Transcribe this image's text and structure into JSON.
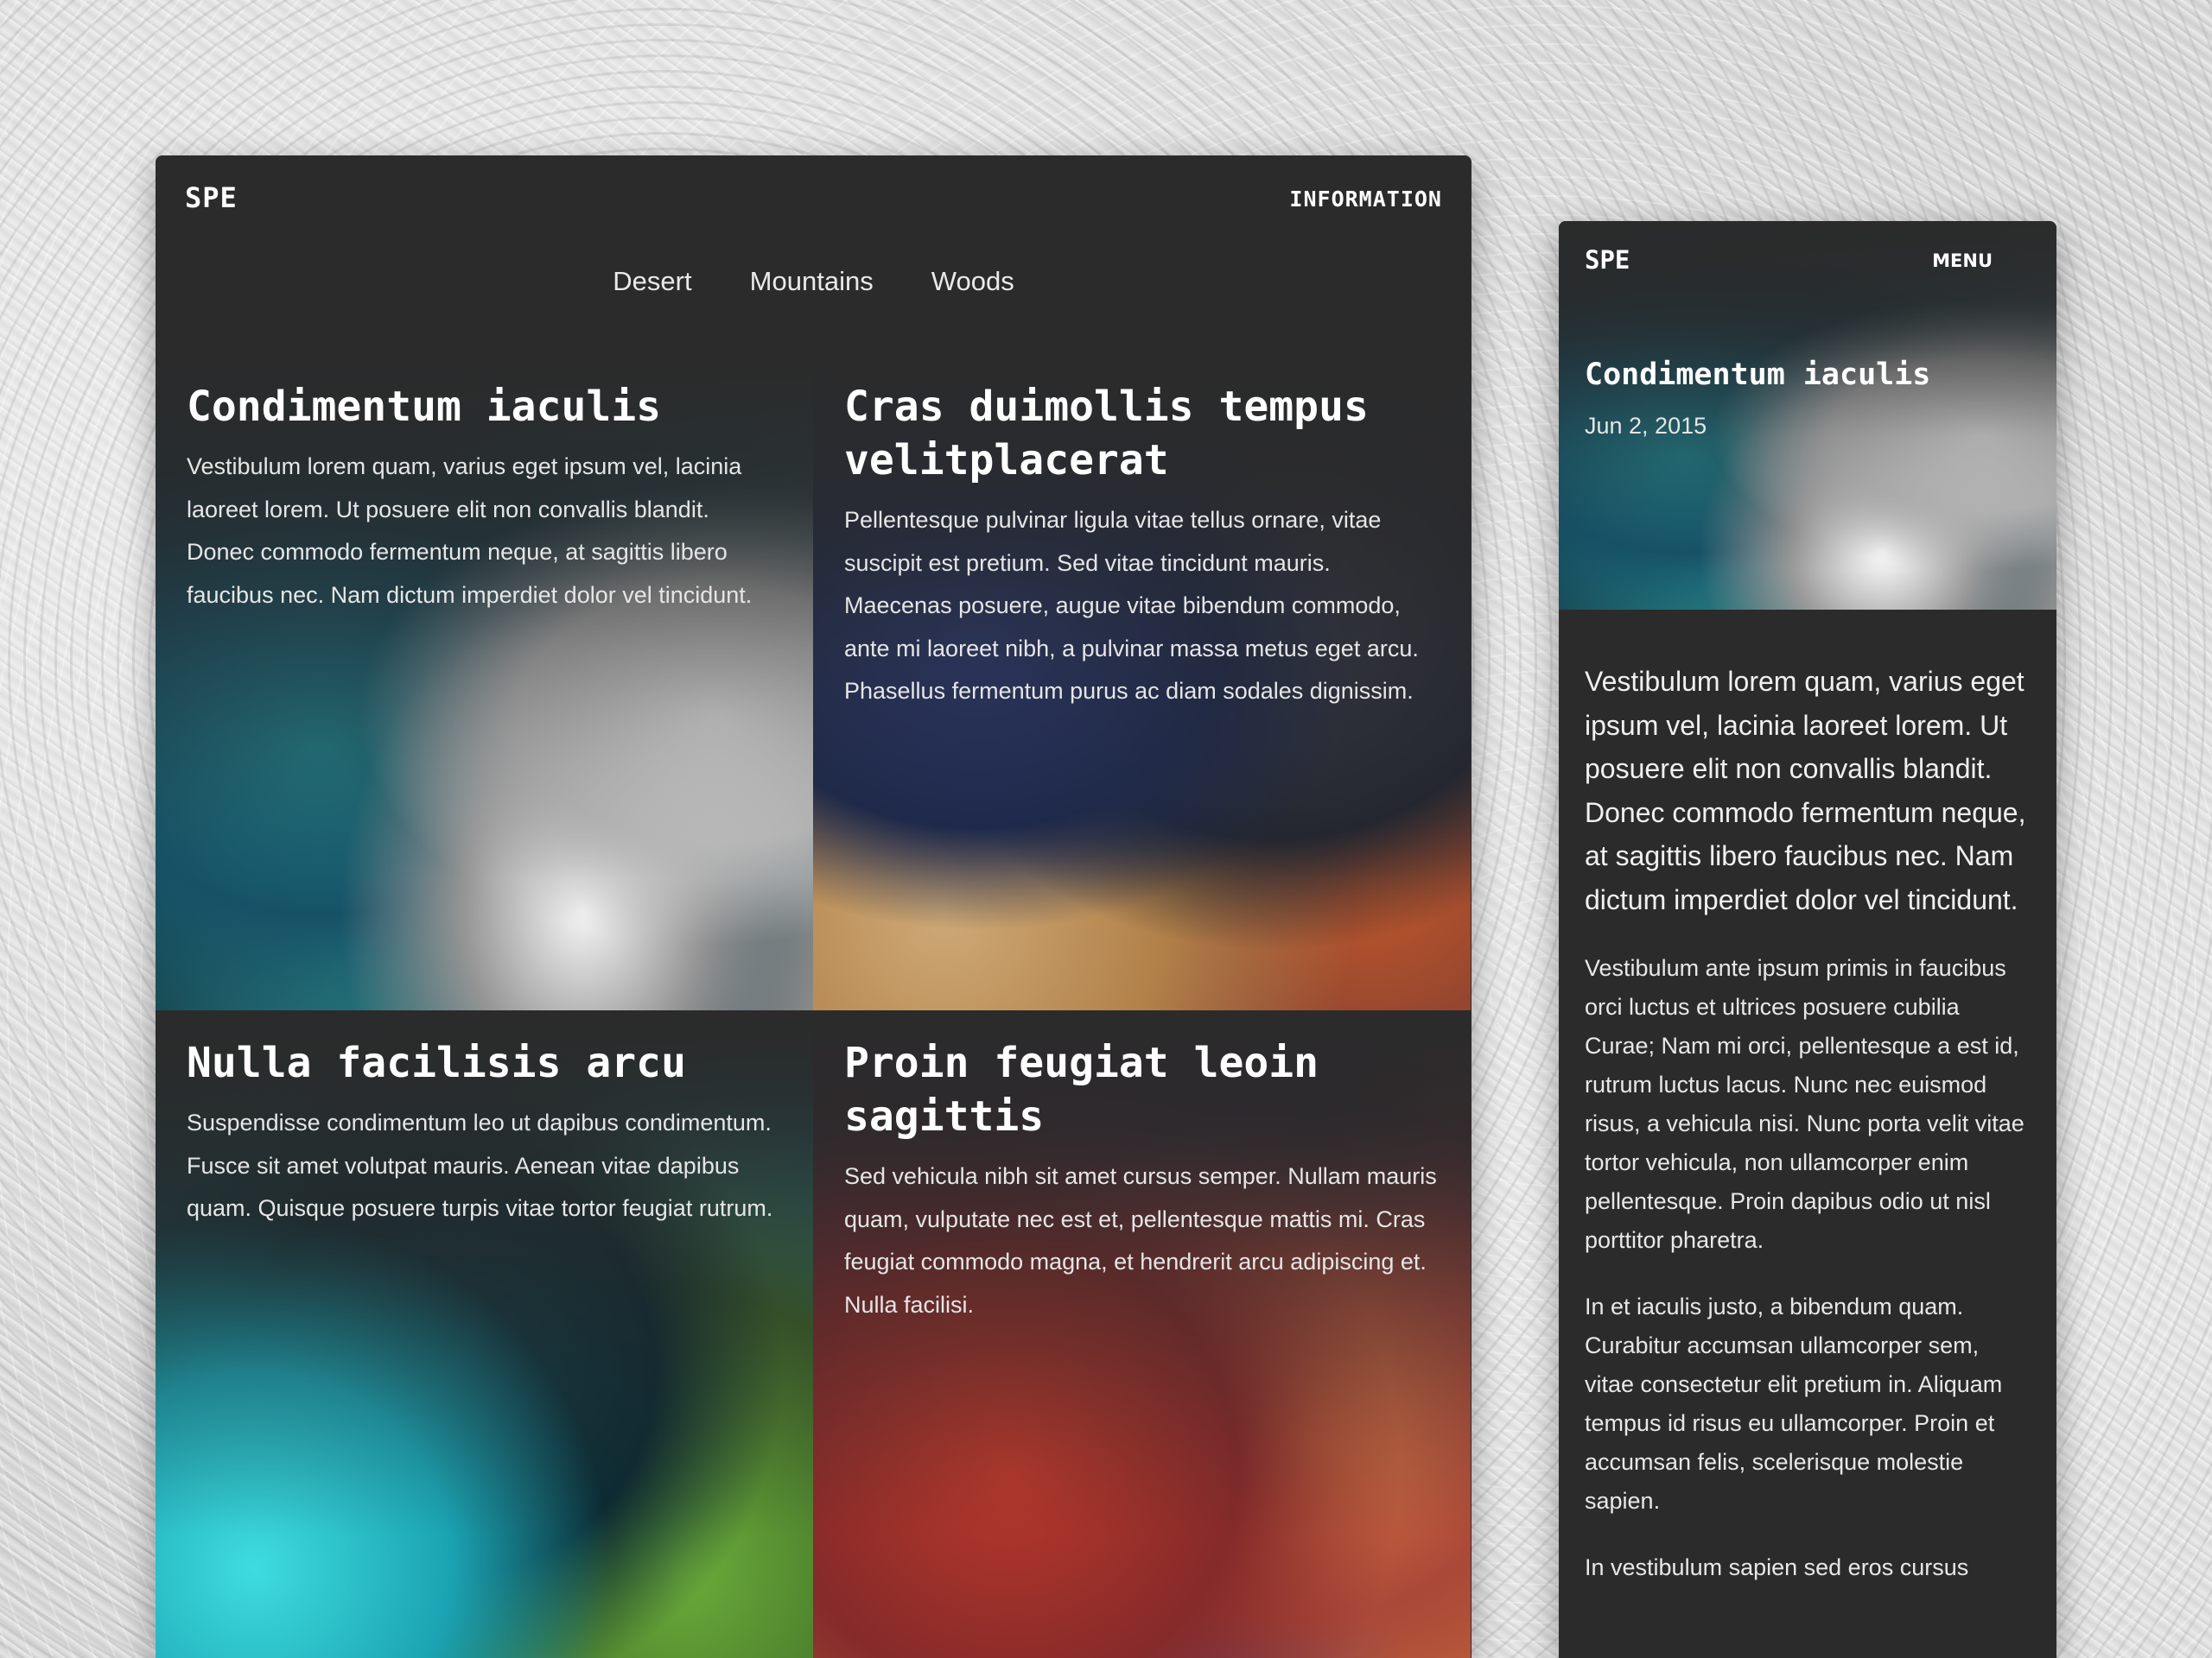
{
  "desktop": {
    "logo": "SPE",
    "info_link": "INFORMATION",
    "nav": [
      "Desert",
      "Mountains",
      "Woods"
    ],
    "cards": [
      {
        "title": "Condimentum iaculis",
        "text": "Vestibulum lorem quam, varius eget ipsum vel, lacinia laoreet lorem. Ut posuere elit non convallis blandit. Donec commodo fermentum neque, at sagittis libero faucibus nec. Nam dictum imperdiet dolor vel tincidunt."
      },
      {
        "title": "Cras duimollis tempus velitplacerat",
        "text": "Pellentesque pulvinar ligula vitae tellus ornare, vitae suscipit est pretium. Sed vitae tincidunt mauris. Maecenas posuere, augue vitae bibendum commodo, ante mi laoreet nibh, a pulvinar massa metus eget arcu. Phasellus fermentum purus ac diam sodales dignissim."
      },
      {
        "title": "Nulla facilisis arcu",
        "text": "Suspendisse condimentum leo ut dapibus condimentum. Fusce sit amet volutpat mauris. Aenean vitae dapibus quam. Quisque posuere turpis vitae tortor feugiat rutrum."
      },
      {
        "title": "Proin feugiat leoin sagittis",
        "text": "Sed vehicula nibh sit amet cursus semper. Nullam mauris quam, vulputate nec est et, pellentesque mattis mi. Cras feugiat commodo magna, et hendrerit arcu adipiscing et. Nulla facilisi."
      }
    ]
  },
  "mobile": {
    "logo": "SPE",
    "menu": "MENU",
    "title": "Condimentum iaculis",
    "date": "Jun 2, 2015",
    "lead": "Vestibulum lorem quam, varius eget ipsum vel, lacinia laoreet lorem. Ut posuere elit non convallis blandit. Donec commodo fermentum neque, at sagittis libero faucibus nec. Nam dictum imperdiet dolor vel tincidunt.",
    "paragraphs": [
      "Vestibulum ante ipsum primis in faucibus orci luctus et ultrices posuere cubilia Curae; Nam mi orci, pellentesque a est id, rutrum luctus lacus. Nunc nec euismod risus, a vehicula nisi. Nunc porta velit vitae tortor vehicula, non ullamcorper enim pellentesque. Proin dapibus odio ut nisl porttitor pharetra.",
      "In et iaculis justo, a bibendum quam. Curabitur accumsan ullamcorper sem, vitae consectetur elit pretium in. Aliquam tempus id risus eu ullamcorper. Proin et accumsan felis, scelerisque molestie sapien.",
      "In vestibulum sapien sed eros cursus"
    ]
  },
  "colors": {
    "panel": "#2b2b2b",
    "text": "#ffffff",
    "body_text": "#e6e6e6"
  }
}
